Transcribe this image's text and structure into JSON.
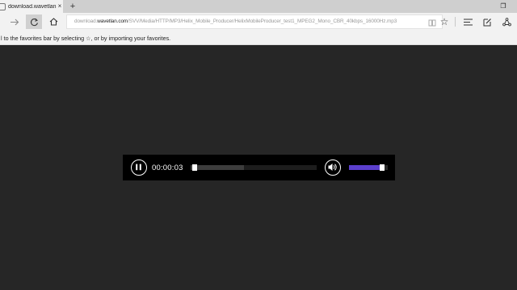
{
  "tab": {
    "title": "download.wavetlan.c",
    "close_glyph": "×"
  },
  "tabstrip": {
    "new_tab_glyph": "+"
  },
  "window": {
    "restore_glyph": "❐"
  },
  "navbar": {
    "back_glyph": "←",
    "forward_glyph": "→",
    "refresh_glyph": "⟳",
    "url_prefix": "download.",
    "url_host": "wavetlan.com",
    "url_path": "/SVV/Media/HTTP/MP3/Helix_Mobile_Producer/HelixMobileProducer_test1_MPEG2_Mono_CBR_40kbps_16000Hz.mp3",
    "favorite_glyph": "☆",
    "hub_glyph": "≡"
  },
  "favbar": {
    "message": "l to the favorites bar by selecting ☆, or by importing your favorites."
  },
  "player": {
    "time": "00:00:03",
    "buffered_fraction": 0.42,
    "playback_fraction": 0.01,
    "volume_fraction": 0.9,
    "volume_fill_color": "#5b3fcc"
  }
}
